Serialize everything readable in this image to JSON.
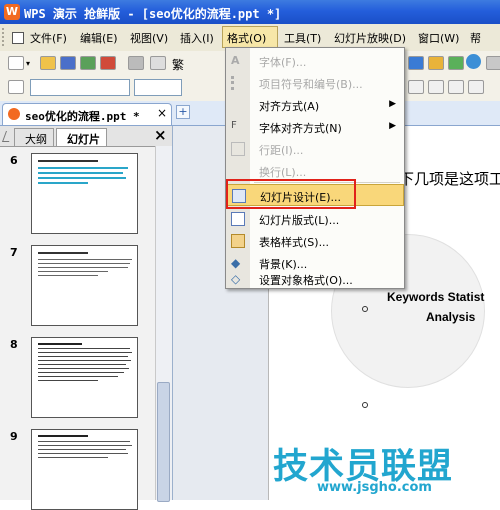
{
  "window": {
    "logo_text": "W",
    "title": "WPS 演示 抢鲜版 - [seo优化的流程.ppt *]"
  },
  "menubar": {
    "items": [
      "文件(F)",
      "编辑(E)",
      "视图(V)",
      "插入(I)",
      "格式(O)",
      "工具(T)",
      "幻灯片放映(D)",
      "窗口(W)",
      "帮"
    ],
    "active_index": 4
  },
  "toolbar": {
    "font_combo_value": "",
    "partial_char": "繁"
  },
  "doc_tabs": {
    "active_tab": "seo优化的流程.ppt *",
    "new_tab_symbol": "+"
  },
  "left_pane": {
    "tabs": [
      "大纲",
      "幻灯片"
    ],
    "active_tab_index": 1,
    "close_symbol": "×",
    "slides": [
      {
        "number": "6"
      },
      {
        "number": "7"
      },
      {
        "number": "8"
      },
      {
        "number": "9"
      }
    ]
  },
  "slide": {
    "heading_fragment": "下几项是这项工",
    "circle_text_line1": "Keywords Statist",
    "circle_text_line2": "Analysis"
  },
  "format_menu": {
    "items": [
      {
        "label": "字体(F)...",
        "icon": "font-icon",
        "disabled": true
      },
      {
        "label": "项目符号和编号(B)...",
        "icon": "bullets-icon",
        "disabled": true
      },
      {
        "label": "对齐方式(A)",
        "icon": "",
        "disabled": false,
        "submenu": true
      },
      {
        "label": "字体对齐方式(N)",
        "icon": "font-align-icon",
        "disabled": false,
        "submenu": true
      },
      {
        "label": "行距(I)...",
        "icon": "line-spacing-icon",
        "disabled": true
      },
      {
        "label": "换行(L)...",
        "icon": "",
        "disabled": true
      },
      {
        "label": "幻灯片设计(E)...",
        "icon": "slide-design-icon",
        "disabled": false,
        "highlighted": true
      },
      {
        "label": "幻灯片版式(L)...",
        "icon": "slide-layout-icon",
        "disabled": false
      },
      {
        "label": "表格样式(S)...",
        "icon": "table-style-icon",
        "disabled": false
      },
      {
        "label": "背景(K)...",
        "icon": "background-icon",
        "disabled": false
      },
      {
        "label": "设置对象格式(O)...",
        "icon": "object-format-icon",
        "disabled": false
      }
    ],
    "submenu_arrow": "▶"
  },
  "watermark": {
    "text_cn": "技术员联盟",
    "url": "www.jsgho.com"
  },
  "colors": {
    "highlight_box": "#e1221a",
    "menu_highlight": "#f9d77a",
    "titlebar": "#245edb"
  }
}
